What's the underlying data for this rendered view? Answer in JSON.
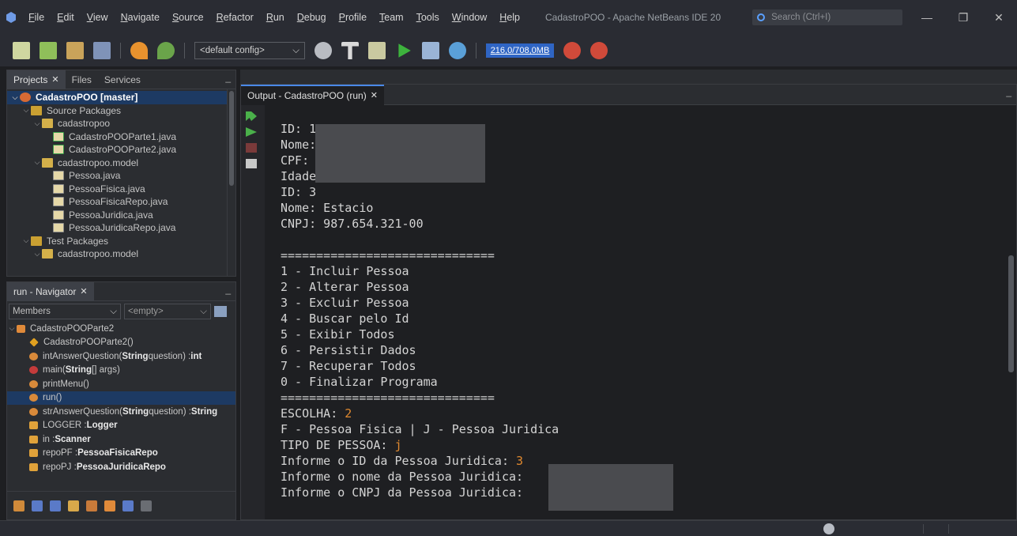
{
  "menubar": {
    "items": [
      "File",
      "Edit",
      "View",
      "Navigate",
      "Source",
      "Refactor",
      "Run",
      "Debug",
      "Profile",
      "Team",
      "Tools",
      "Window",
      "Help"
    ],
    "window_title": "CadastroPOO - Apache NetBeans IDE 20",
    "search_placeholder": "Search (Ctrl+I)",
    "minimize": "—",
    "maximize": "❐",
    "close": "✕"
  },
  "toolbar": {
    "config": "<default config>",
    "memory": "216,0/708,0MB"
  },
  "projects_panel": {
    "tabs": [
      "Projects",
      "Files",
      "Services"
    ],
    "close_glyph": "✕",
    "minimize": "_",
    "tree": [
      {
        "label": "CadastroPOO [master]",
        "icon": "project",
        "level": 0,
        "expanded": true,
        "selected": true
      },
      {
        "label": "Source Packages",
        "icon": "folder",
        "level": 1,
        "expanded": true
      },
      {
        "label": "cadastropoo",
        "icon": "package",
        "level": 2,
        "expanded": true
      },
      {
        "label": "CadastroPOOParte1.java",
        "icon": "java-run",
        "level": 3
      },
      {
        "label": "CadastroPOOParte2.java",
        "icon": "java-run",
        "level": 3
      },
      {
        "label": "cadastropoo.model",
        "icon": "package",
        "level": 2,
        "expanded": true
      },
      {
        "label": "Pessoa.java",
        "icon": "java",
        "level": 3
      },
      {
        "label": "PessoaFisica.java",
        "icon": "java",
        "level": 3
      },
      {
        "label": "PessoaFisicaRepo.java",
        "icon": "java",
        "level": 3
      },
      {
        "label": "PessoaJuridica.java",
        "icon": "java",
        "level": 3
      },
      {
        "label": "PessoaJuridicaRepo.java",
        "icon": "java",
        "level": 3
      },
      {
        "label": "Test Packages",
        "icon": "folder",
        "level": 1,
        "expanded": true
      },
      {
        "label": "cadastropoo.model",
        "icon": "package",
        "level": 2,
        "expanded": true
      }
    ]
  },
  "navigator_panel": {
    "title": "run - Navigator",
    "filter_label": "Members",
    "filter_value": "<empty>",
    "class_name": "CadastroPOOParte2",
    "members": [
      {
        "icon": "constructor",
        "parts": [
          [
            "CadastroPOOParte2()",
            false
          ]
        ]
      },
      {
        "icon": "method",
        "parts": [
          [
            "intAnswerQuestion(",
            false
          ],
          [
            "String",
            true
          ],
          [
            " question) : ",
            false
          ],
          [
            "int",
            true
          ]
        ]
      },
      {
        "icon": "main",
        "parts": [
          [
            "main(",
            false
          ],
          [
            "String",
            true
          ],
          [
            "[] args)",
            false
          ]
        ]
      },
      {
        "icon": "method",
        "parts": [
          [
            "printMenu()",
            false
          ]
        ]
      },
      {
        "icon": "method",
        "parts": [
          [
            "run()",
            false
          ]
        ],
        "selected": true
      },
      {
        "icon": "method",
        "parts": [
          [
            "strAnswerQuestion(",
            false
          ],
          [
            "String",
            true
          ],
          [
            " question) : ",
            false
          ],
          [
            "String",
            true
          ]
        ]
      },
      {
        "icon": "field",
        "parts": [
          [
            "LOGGER : ",
            false
          ],
          [
            "Logger",
            true
          ]
        ]
      },
      {
        "icon": "field",
        "parts": [
          [
            "in : ",
            false
          ],
          [
            "Scanner",
            true
          ]
        ]
      },
      {
        "icon": "field",
        "parts": [
          [
            "repoPF : ",
            false
          ],
          [
            "PessoaFisicaRepo",
            true
          ]
        ]
      },
      {
        "icon": "field",
        "parts": [
          [
            "repoPJ : ",
            false
          ],
          [
            "PessoaJuridicaRepo",
            true
          ]
        ]
      }
    ]
  },
  "output_panel": {
    "tab_title": "Output - CadastroPOO (run)",
    "close_glyph": "✕",
    "minimize": "_",
    "lines": [
      [
        [
          "ID: 1",
          ""
        ]
      ],
      [
        [
          "Nome:",
          ""
        ]
      ],
      [
        [
          "CPF: :",
          ""
        ]
      ],
      [
        [
          "Idade",
          ""
        ]
      ],
      [
        [
          "ID: 3",
          ""
        ]
      ],
      [
        [
          "Nome: Estacio",
          ""
        ]
      ],
      [
        [
          "CNPJ: 987.654.321-00",
          ""
        ]
      ],
      [
        [
          "",
          ""
        ]
      ],
      [
        [
          "==============================",
          ""
        ]
      ],
      [
        [
          "1 - Incluir Pessoa",
          ""
        ]
      ],
      [
        [
          "2 - Alterar Pessoa",
          ""
        ]
      ],
      [
        [
          "3 - Excluir Pessoa",
          ""
        ]
      ],
      [
        [
          "4 - Buscar pelo Id",
          ""
        ]
      ],
      [
        [
          "5 - Exibir Todos",
          ""
        ]
      ],
      [
        [
          "6 - Persistir Dados",
          ""
        ]
      ],
      [
        [
          "7 - Recuperar Todos",
          ""
        ]
      ],
      [
        [
          "0 - Finalizar Programa",
          ""
        ]
      ],
      [
        [
          "==============================",
          ""
        ]
      ],
      [
        [
          "ESCOLHA: ",
          ""
        ],
        [
          "2",
          "inp"
        ]
      ],
      [
        [
          "F - Pessoa Fisica | J - Pessoa Juridica",
          ""
        ]
      ],
      [
        [
          "TIPO DE PESSOA: ",
          ""
        ],
        [
          "j",
          "inp"
        ]
      ],
      [
        [
          "Informe o ID da Pessoa Juridica: ",
          ""
        ],
        [
          "3",
          "inp"
        ]
      ],
      [
        [
          "Informe o nome da Pessoa Juridica:",
          ""
        ]
      ],
      [
        [
          "Informe o CNPJ da Pessoa Juridica:",
          ""
        ]
      ]
    ]
  }
}
